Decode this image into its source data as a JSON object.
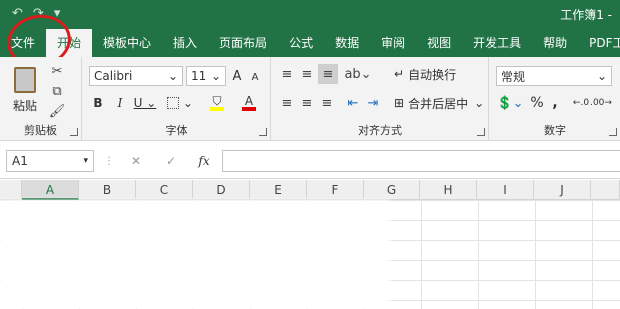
{
  "window": {
    "title": "工作簿1 -"
  },
  "qat": {
    "undo": "↶",
    "redo": "↷",
    "customize": "▾"
  },
  "tabs": [
    {
      "label": "文件"
    },
    {
      "label": "开始"
    },
    {
      "label": "模板中心"
    },
    {
      "label": "插入"
    },
    {
      "label": "页面布局"
    },
    {
      "label": "公式"
    },
    {
      "label": "数据"
    },
    {
      "label": "审阅"
    },
    {
      "label": "视图"
    },
    {
      "label": "开发工具"
    },
    {
      "label": "帮助"
    },
    {
      "label": "PDF工具"
    }
  ],
  "clipboard": {
    "group": "剪贴板",
    "paste": "粘贴"
  },
  "font": {
    "group": "字体",
    "name": "Calibri",
    "size": "11",
    "bold": "B",
    "italic": "I",
    "underline": "U",
    "grow": "A",
    "shrink": "A",
    "color_letter": "A",
    "font_color": "#e00000",
    "fill_color": "#ffff00"
  },
  "alignment": {
    "group": "对齐方式",
    "wrap": "自动换行",
    "merge": "合并后居中"
  },
  "number": {
    "group": "数字",
    "format": "常规",
    "percent": "%",
    "comma": ","
  },
  "formula_bar": {
    "name_box": "A1",
    "cancel": "✕",
    "enter": "✓",
    "fx": "fx",
    "content": ""
  },
  "columns": [
    "A",
    "B",
    "C",
    "D",
    "E",
    "F",
    "G",
    "H",
    "I",
    "J"
  ],
  "accent": "#217346",
  "annotation": {
    "color": "#d91d1d"
  }
}
